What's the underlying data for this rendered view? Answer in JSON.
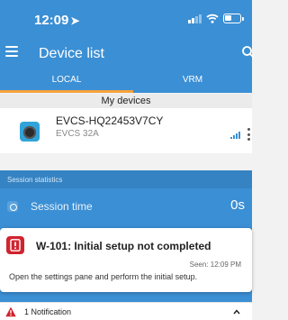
{
  "status_bar": {
    "time": "12:09",
    "location_arrow": "➤",
    "icons": [
      "cellular-signal-icon",
      "wifi-icon",
      "battery-icon"
    ]
  },
  "app_bar": {
    "title": "Device list",
    "icons": [
      "menu-icon",
      "search-icon"
    ]
  },
  "tabs": [
    {
      "label": "LOCAL",
      "active": true
    },
    {
      "label": "VRM",
      "active": false
    }
  ],
  "section": {
    "title": "My devices"
  },
  "devices": [
    {
      "name": "EVCS-HQ22453V7CY",
      "model": "EVCS 32A",
      "icon": "charging-station-icon"
    }
  ],
  "stats": {
    "header": "Session statistics",
    "session_time_label": "Session time",
    "session_time_value": "0s"
  },
  "toast": {
    "code_title": "W-101: Initial setup not completed",
    "seen": "Seen: 12:09 PM",
    "message": "Open the settings pane and perform the initial setup.",
    "icon": "warning-document-icon"
  },
  "notification_bar": {
    "label": "1 Notification",
    "icon": "warning-triangle-icon"
  },
  "colors": {
    "brand_blue": "#3b8fd4",
    "tab_indicator": "#f5a23c",
    "alert_red": "#d0242f"
  }
}
